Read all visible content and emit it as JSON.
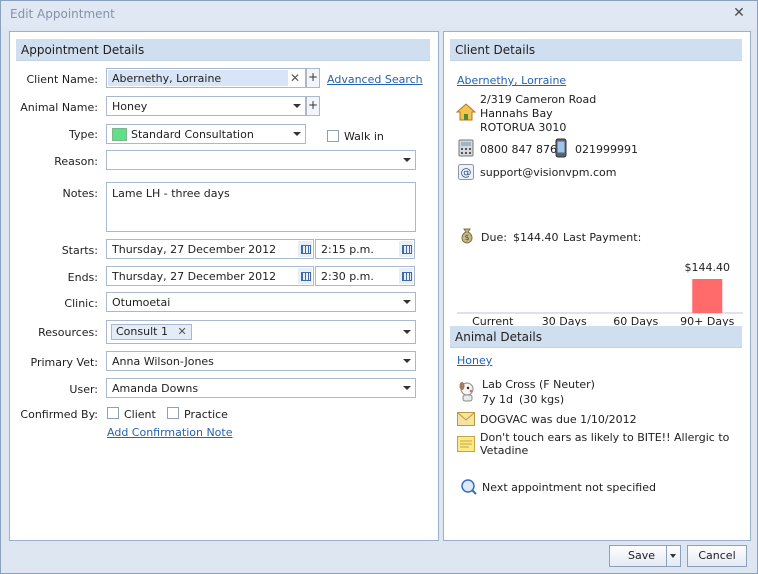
{
  "window": {
    "title": "Edit Appointment"
  },
  "appointment": {
    "header": "Appointment Details",
    "client_name_label": "Client Name:",
    "client_name_value": "Abernethy, Lorraine",
    "advanced_search": "Advanced Search",
    "animal_name_label": "Animal Name:",
    "animal_name_value": "Honey",
    "type_label": "Type:",
    "type_value": "Standard Consultation",
    "type_color": "#5ee08a",
    "walk_in_label": "Walk in",
    "reason_label": "Reason:",
    "reason_value": "",
    "notes_label": "Notes:",
    "notes_value": "Lame LH - three days",
    "starts_label": "Starts:",
    "starts_date": "Thursday, 27 December 2012",
    "starts_time": "2:15 p.m.",
    "ends_label": "Ends:",
    "ends_date": "Thursday, 27 December 2012",
    "ends_time": "2:30 p.m.",
    "clinic_label": "Clinic:",
    "clinic_value": "Otumoetai",
    "resources_label": "Resources:",
    "resource_chip": "Consult 1",
    "primary_vet_label": "Primary Vet:",
    "primary_vet_value": "Anna Wilson-Jones",
    "user_label": "User:",
    "user_value": "Amanda Downs",
    "confirmed_by_label": "Confirmed By:",
    "confirm_client": "Client",
    "confirm_practice": "Practice",
    "add_confirmation_note": "Add Confirmation Note"
  },
  "client": {
    "header": "Client Details",
    "name_link": "Abernethy, Lorraine",
    "address_line1": "2/319 Cameron Road",
    "address_line2": "Hannahs Bay",
    "address_line3": "ROTORUA  3010",
    "phone": "0800 847 876",
    "mobile": "021999991",
    "email": "support@visionvpm.com",
    "due_label": "Due:",
    "due_value": "$144.40",
    "last_payment_label": "Last Payment:",
    "last_payment_value": ""
  },
  "chart_data": {
    "type": "bar",
    "categories": [
      "Current",
      "30 Days",
      "60 Days",
      "90+ Days"
    ],
    "values": [
      0,
      0,
      0,
      144.4
    ],
    "data_labels": [
      "",
      "",
      "",
      "$144.40"
    ],
    "bar_color": "#ff6b6b",
    "ylim": [
      0,
      144.4
    ],
    "grid": false
  },
  "animal": {
    "header": "Animal Details",
    "name_link": "Honey",
    "breed": "Lab Cross",
    "sex": "(F Neuter)",
    "age": "7y 1d",
    "weight": "(30 kgs)",
    "vaccination": "DOGVAC was due 1/10/2012",
    "note_line1": "Don't touch ears as likely to BITE!! Allergic to",
    "note_line2": "Vetadine",
    "next_appointment": "Next appointment not specified"
  },
  "buttons": {
    "save": "Save",
    "cancel": "Cancel"
  }
}
